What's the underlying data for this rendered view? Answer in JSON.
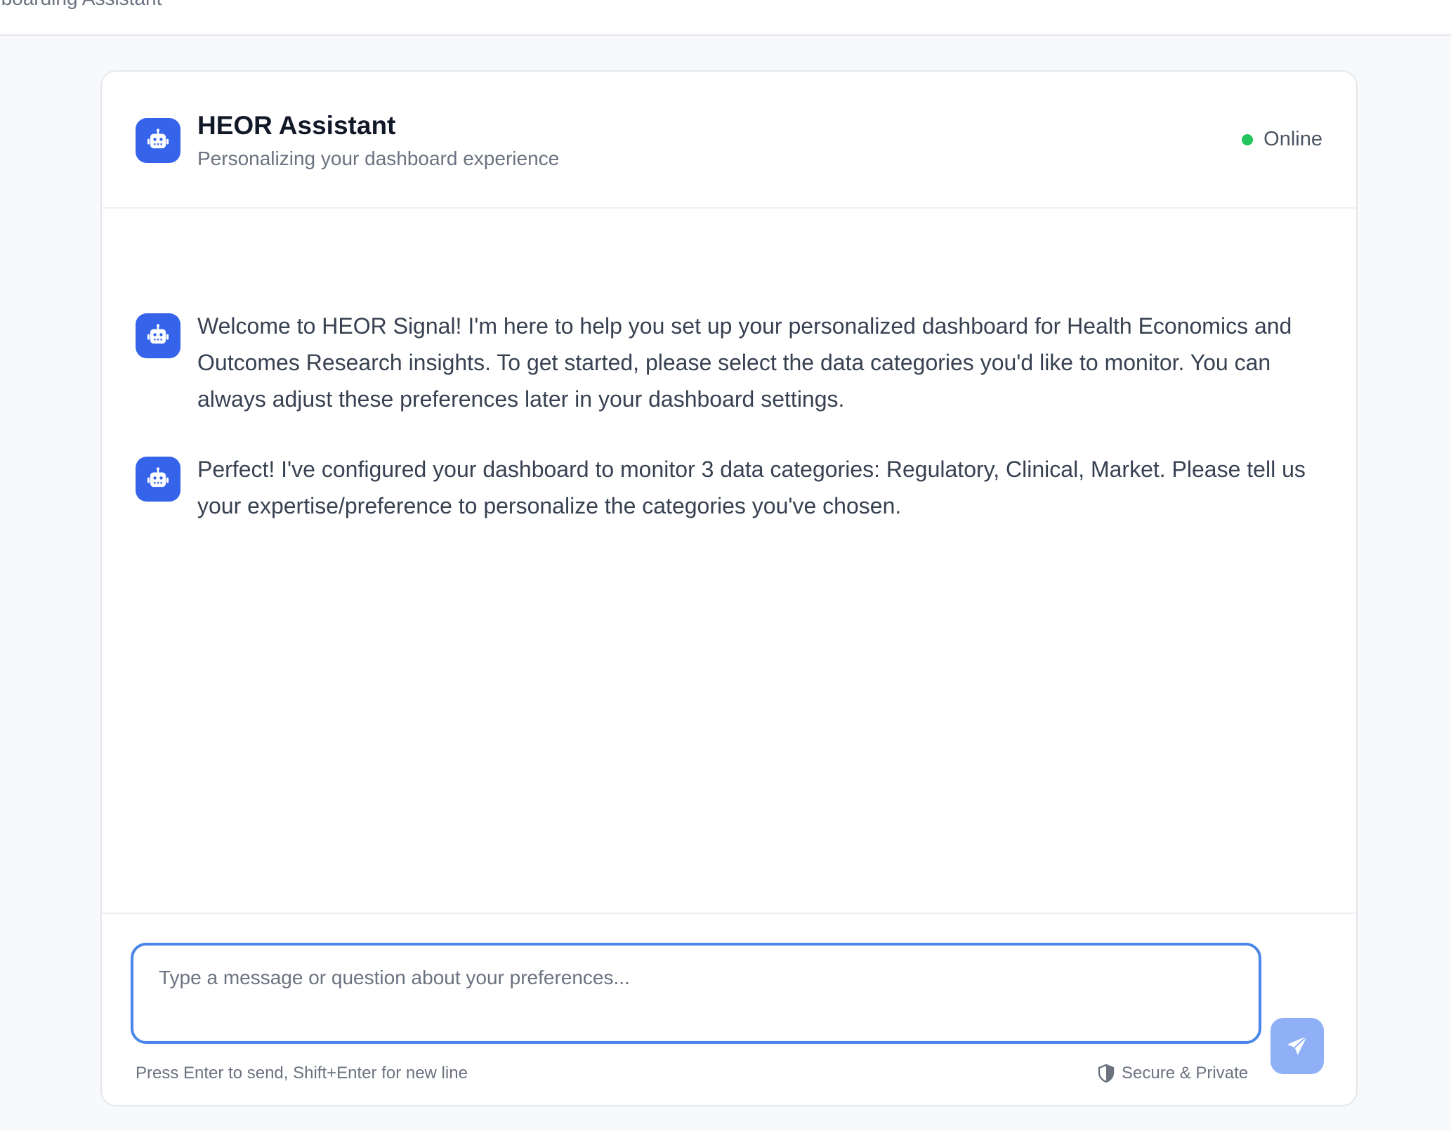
{
  "page": {
    "title": "nboarding Assistant"
  },
  "header": {
    "assistant_name": "HEOR Assistant",
    "subtitle": "Personalizing your dashboard experience",
    "status": "Online",
    "avatar_icon": "robot-icon",
    "status_color": "#22c55e"
  },
  "messages": [
    {
      "sender": "assistant",
      "text": "Welcome to HEOR Signal! I'm here to help you set up your personalized dashboard for Health Economics and Outcomes Research insights. To get started, please select the data categories you'd like to monitor. You can always adjust these preferences later in your dashboard settings."
    },
    {
      "sender": "assistant",
      "text": "Perfect! I've configured your dashboard to monitor 3 data categories: Regulatory, Clinical, Market. Please tell us your expertise/preference to personalize the categories you've chosen."
    }
  ],
  "composer": {
    "placeholder": "Type a message or question about your preferences...",
    "value": "",
    "hint": "Press Enter to send, Shift+Enter for new line",
    "secure_label": "Secure & Private",
    "secure_icon": "shield-icon",
    "send_icon": "send-icon"
  },
  "colors": {
    "accent": "#3563e9",
    "input_border": "#4a86e8",
    "send_button": "#8fb0f7"
  }
}
